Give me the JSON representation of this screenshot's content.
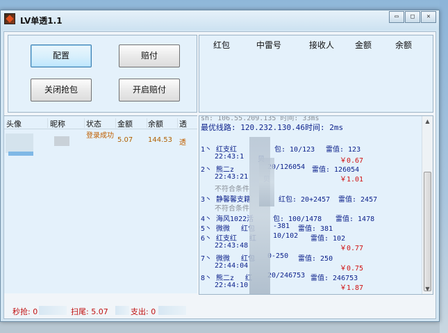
{
  "window": {
    "title": "LV单透1.1",
    "controls": [
      "▭",
      "□",
      "✕"
    ]
  },
  "buttons": {
    "config": "配置",
    "pay": "赔付",
    "close_grab": "关闭抢包",
    "open_pay": "开启赔付"
  },
  "top_table": {
    "columns": [
      "红包",
      "中雷号",
      "接收人",
      "金额",
      "余额"
    ]
  },
  "left_list": {
    "columns": [
      "头像",
      "昵称",
      "状态",
      "金额",
      "余额",
      "透"
    ],
    "row": {
      "status": "登录成功",
      "amount": "5.07",
      "balance": "144.53",
      "tou": "透"
    }
  },
  "log": {
    "line0": "sh: 106.55.209.135 时间: 33ms",
    "line1": "最优线路: 120.232.130.46时间: 2ms",
    "e1a": "1丶 红支红",
    "e1b": "包: 10/123",
    "e1c": "雷值: 123",
    "e1t": "22:43:1",
    "e1u": "贝",
    "e1m": "￥0.67",
    "e2a": "2丶 熊二z",
    "e2b": "20/126054",
    "e2c": "雷值: 126054",
    "e2t": "22:43:21",
    "e2u": "贝",
    "e2m": "￥1.01",
    "e2n": "不符合条件",
    "e3a": "3丶 静馨馨支籍",
    "e3b": "红包: 20+2457",
    "e3c": "雷值: 2457",
    "e3n": "不符合条件",
    "e4a": "4丶 海风1022活",
    "e4b": "包: 100/1478",
    "e4c": "雷值: 1478",
    "e5a": "5丶 微微",
    "e5b": "红包",
    "e5c": "-381",
    "e5d": "雷值: 381",
    "e6a": "6丶 红支红",
    "e6b": "红",
    "e6c": "10/102",
    "e6d": "雷值: 102",
    "e6t": "22:43:48",
    "e6m": "￥0.77",
    "e7a": "7丶 微微",
    "e7b": "红包",
    "e7c": "0-250",
    "e7d": "雷值: 250",
    "e7t": "22:44:04",
    "e7m": "￥0.75",
    "e8a": "8丶 熊二z",
    "e8b": "红",
    "e8c": "20/246753",
    "e8d": "雷值: 246753",
    "e8t": "22:44:10",
    "e8m": "￥1.87"
  },
  "footer": {
    "miao": "秒抢: 0",
    "saowei": "扫尾: 5.07",
    "zhichu": "支出: 0"
  },
  "scrollbar": {
    "up": "▲",
    "down": "▼"
  }
}
